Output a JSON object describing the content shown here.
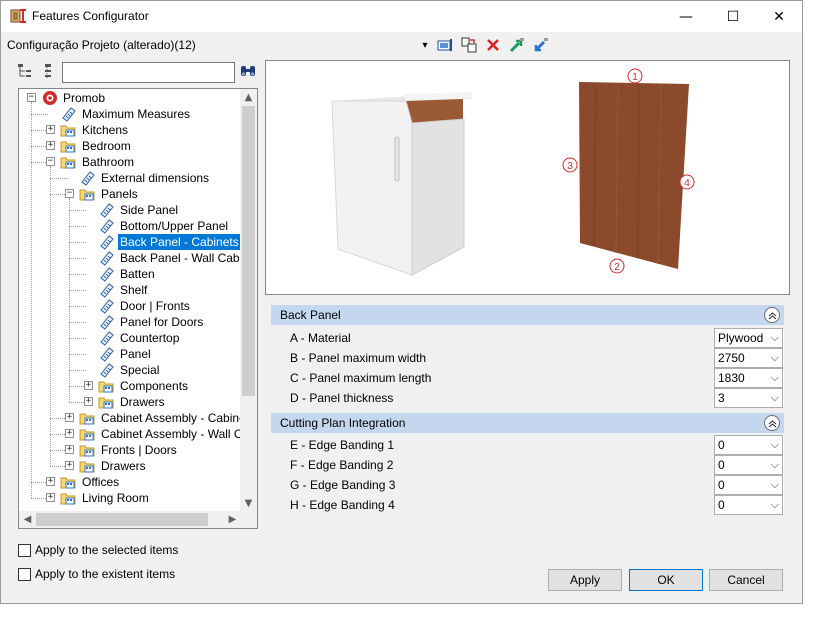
{
  "window": {
    "title": "Features Configurator",
    "controls": {
      "minimize": "—",
      "maximize": "☐",
      "close": "✕"
    }
  },
  "project": {
    "label": "Configuração Projeto (alterado)(12)",
    "dropdown_arrow": "▾"
  },
  "toolbar": {
    "icons": [
      "panel-settings-icon",
      "copy-paste-icon",
      "delete-x-icon",
      "export-icon",
      "import-icon"
    ]
  },
  "search": {
    "value": "",
    "placeholder": ""
  },
  "tree": {
    "nodes": [
      {
        "label": "Promob",
        "icon": "promob-logo-icon",
        "expander": "−"
      },
      {
        "label": "Maximum Measures",
        "icon": "ruler-icon"
      },
      {
        "label": "Kitchens",
        "icon": "folder-icon",
        "expander": "+"
      },
      {
        "label": "Bedroom",
        "icon": "folder-icon",
        "expander": "+"
      },
      {
        "label": "Bathroom",
        "icon": "folder-icon",
        "expander": "−"
      },
      {
        "label": "External dimensions",
        "icon": "ruler-icon"
      },
      {
        "label": "Panels",
        "icon": "folder-icon",
        "expander": "−"
      },
      {
        "label": "Side Panel",
        "icon": "ruler-icon"
      },
      {
        "label": "Bottom/Upper Panel",
        "icon": "ruler-icon"
      },
      {
        "label": "Back Panel - Cabinets",
        "icon": "ruler-icon",
        "selected": true
      },
      {
        "label": "Back Panel - Wall Cabinets",
        "icon": "ruler-icon"
      },
      {
        "label": "Batten",
        "icon": "ruler-icon"
      },
      {
        "label": "Shelf",
        "icon": "ruler-icon"
      },
      {
        "label": "Door | Fronts",
        "icon": "ruler-icon"
      },
      {
        "label": "Panel for Doors",
        "icon": "ruler-icon"
      },
      {
        "label": "Countertop",
        "icon": "ruler-icon"
      },
      {
        "label": "Panel",
        "icon": "ruler-icon"
      },
      {
        "label": "Special",
        "icon": "ruler-icon"
      },
      {
        "label": "Components",
        "icon": "folder-icon",
        "expander": "+"
      },
      {
        "label": "Drawers",
        "icon": "folder-icon",
        "expander": "+"
      },
      {
        "label": "Cabinet Assembly - Cabinets",
        "icon": "folder-icon",
        "expander": "+"
      },
      {
        "label": "Cabinet Assembly - Wall Cabinets",
        "icon": "folder-icon",
        "expander": "+"
      },
      {
        "label": "Fronts | Doors",
        "icon": "folder-icon",
        "expander": "+"
      },
      {
        "label": "Drawers",
        "icon": "folder-icon",
        "expander": "+"
      },
      {
        "label": "Offices",
        "icon": "folder-icon",
        "expander": "+"
      },
      {
        "label": "Living Room",
        "icon": "folder-icon",
        "expander": "+"
      }
    ]
  },
  "preview": {
    "markers": [
      "1",
      "2",
      "3",
      "4"
    ]
  },
  "groups": [
    {
      "title": "Back Panel",
      "toggle": "≈",
      "properties": [
        {
          "name": "A - Material",
          "value": "Plywood"
        },
        {
          "name": "B - Panel maximum width",
          "value": "2750"
        },
        {
          "name": "C - Panel maximum length",
          "value": "1830"
        },
        {
          "name": "D - Panel thickness",
          "value": "3"
        }
      ]
    },
    {
      "title": "Cutting Plan Integration",
      "toggle": "≈",
      "properties": [
        {
          "name": "E - Edge Banding 1",
          "value": "0"
        },
        {
          "name": "F - Edge Banding 2",
          "value": "0"
        },
        {
          "name": "G - Edge Banding 3",
          "value": "0"
        },
        {
          "name": "H - Edge Banding 4",
          "value": "0"
        }
      ]
    }
  ],
  "options": {
    "apply_selected": "Apply to the selected items",
    "apply_existent": "Apply to the existent items"
  },
  "buttons": {
    "apply": "Apply",
    "ok": "OK",
    "cancel": "Cancel"
  },
  "colors": {
    "selection": "#0078d7",
    "group_header": "#c4d7ee",
    "wood": "#8a4a2b",
    "marker": "#d22b2b"
  }
}
